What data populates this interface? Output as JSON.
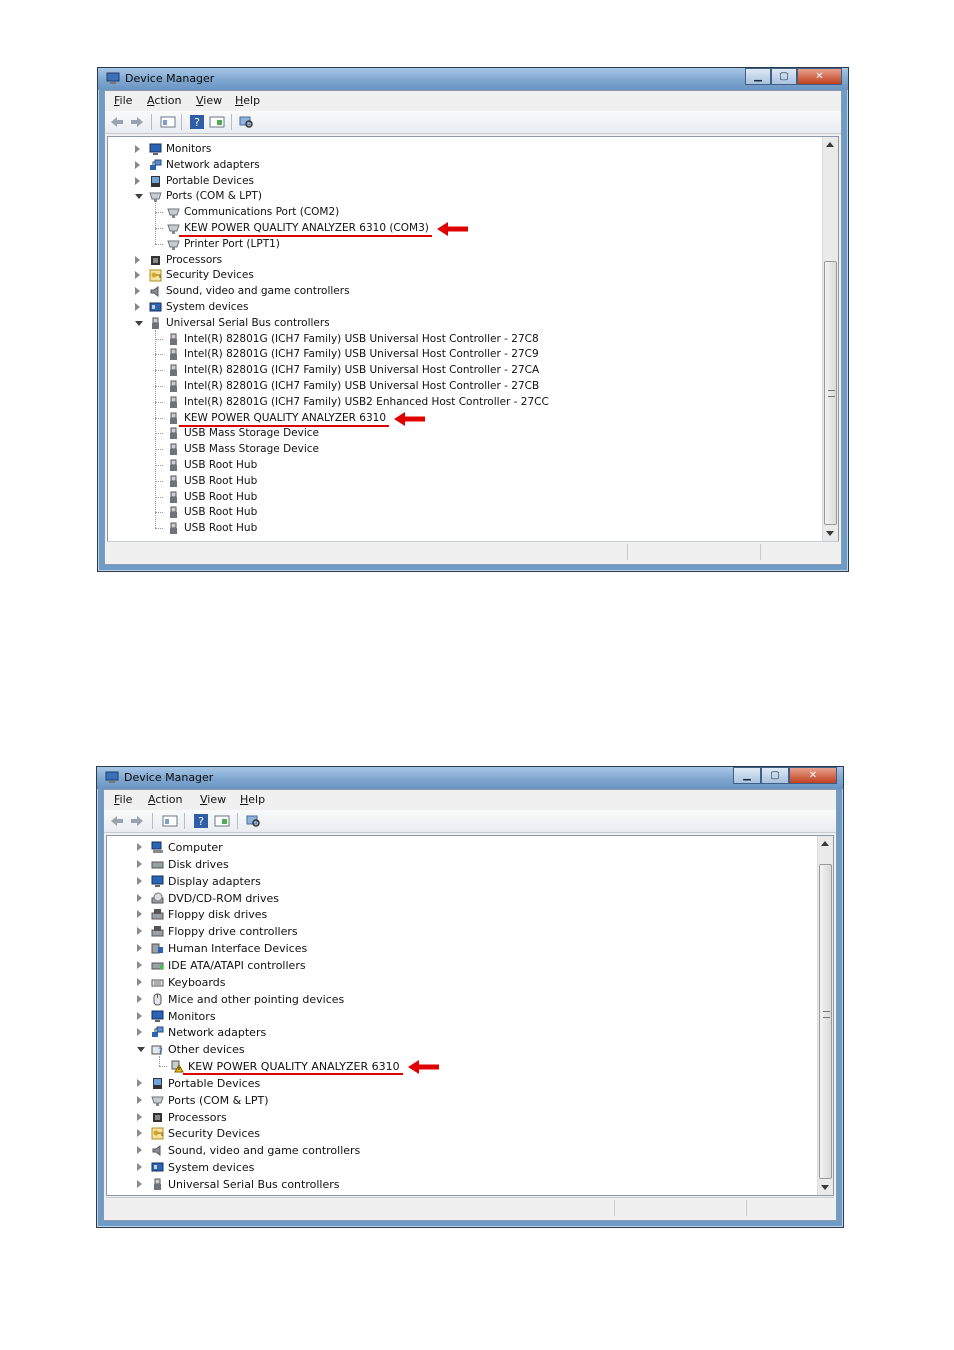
{
  "window_top": {
    "title": "Device Manager",
    "menu": [
      "File",
      "Action",
      "View",
      "Help"
    ],
    "tree": [
      {
        "label": "Monitors",
        "level": 0,
        "state": "collapsed",
        "icon": "monitor-icon"
      },
      {
        "label": "Network adapters",
        "level": 0,
        "state": "collapsed",
        "icon": "network-icon"
      },
      {
        "label": "Portable Devices",
        "level": 0,
        "state": "collapsed",
        "icon": "portable-device-icon"
      },
      {
        "label": "Ports (COM & LPT)",
        "level": 0,
        "state": "expanded",
        "icon": "port-icon"
      },
      {
        "label": "Communications Port (COM2)",
        "level": 1,
        "icon": "port-icon"
      },
      {
        "label": "KEW POWER QUALITY ANALYZER 6310 (COM3)",
        "level": 1,
        "icon": "port-icon",
        "highlight": true
      },
      {
        "label": "Printer Port (LPT1)",
        "level": 1,
        "icon": "port-icon"
      },
      {
        "label": "Processors",
        "level": 0,
        "state": "collapsed",
        "icon": "processor-icon"
      },
      {
        "label": "Security Devices",
        "level": 0,
        "state": "collapsed",
        "icon": "key-icon"
      },
      {
        "label": "Sound, video and game controllers",
        "level": 0,
        "state": "collapsed",
        "icon": "speaker-icon"
      },
      {
        "label": "System devices",
        "level": 0,
        "state": "collapsed",
        "icon": "system-icon"
      },
      {
        "label": "Universal Serial Bus controllers",
        "level": 0,
        "state": "expanded",
        "icon": "usb-icon"
      },
      {
        "label": "Intel(R) 82801G (ICH7 Family) USB Universal Host Controller - 27C8",
        "level": 1,
        "icon": "usb-icon"
      },
      {
        "label": "Intel(R) 82801G (ICH7 Family) USB Universal Host Controller - 27C9",
        "level": 1,
        "icon": "usb-icon"
      },
      {
        "label": "Intel(R) 82801G (ICH7 Family) USB Universal Host Controller - 27CA",
        "level": 1,
        "icon": "usb-icon"
      },
      {
        "label": "Intel(R) 82801G (ICH7 Family) USB Universal Host Controller - 27CB",
        "level": 1,
        "icon": "usb-icon"
      },
      {
        "label": "Intel(R) 82801G (ICH7 Family) USB2 Enhanced Host Controller - 27CC",
        "level": 1,
        "icon": "usb-icon"
      },
      {
        "label": "KEW POWER QUALITY ANALYZER 6310",
        "level": 1,
        "icon": "usb-icon",
        "highlight": true
      },
      {
        "label": "USB Mass Storage Device",
        "level": 1,
        "icon": "usb-icon"
      },
      {
        "label": "USB Mass Storage Device",
        "level": 1,
        "icon": "usb-icon"
      },
      {
        "label": "USB Root Hub",
        "level": 1,
        "icon": "usb-icon"
      },
      {
        "label": "USB Root Hub",
        "level": 1,
        "icon": "usb-icon"
      },
      {
        "label": "USB Root Hub",
        "level": 1,
        "icon": "usb-icon"
      },
      {
        "label": "USB Root Hub",
        "level": 1,
        "icon": "usb-icon"
      },
      {
        "label": "USB Root Hub",
        "level": 1,
        "icon": "usb-icon"
      }
    ]
  },
  "window_bottom": {
    "title": "Device Manager",
    "menu": [
      "File",
      "Action",
      "View",
      "Help"
    ],
    "tree": [
      {
        "label": "Computer",
        "level": 0,
        "state": "collapsed",
        "icon": "computer-icon"
      },
      {
        "label": "Disk drives",
        "level": 0,
        "state": "collapsed",
        "icon": "disk-drive-icon"
      },
      {
        "label": "Display adapters",
        "level": 0,
        "state": "collapsed",
        "icon": "monitor-icon"
      },
      {
        "label": "DVD/CD-ROM drives",
        "level": 0,
        "state": "collapsed",
        "icon": "dvd-icon"
      },
      {
        "label": "Floppy disk drives",
        "level": 0,
        "state": "collapsed",
        "icon": "floppy-icon"
      },
      {
        "label": "Floppy drive controllers",
        "level": 0,
        "state": "collapsed",
        "icon": "floppy-icon"
      },
      {
        "label": "Human Interface Devices",
        "level": 0,
        "state": "collapsed",
        "icon": "hid-icon"
      },
      {
        "label": "IDE ATA/ATAPI controllers",
        "level": 0,
        "state": "collapsed",
        "icon": "ide-icon"
      },
      {
        "label": "Keyboards",
        "level": 0,
        "state": "collapsed",
        "icon": "keyboard-icon"
      },
      {
        "label": "Mice and other pointing devices",
        "level": 0,
        "state": "collapsed",
        "icon": "mouse-icon"
      },
      {
        "label": "Monitors",
        "level": 0,
        "state": "collapsed",
        "icon": "monitor-icon"
      },
      {
        "label": "Network adapters",
        "level": 0,
        "state": "collapsed",
        "icon": "network-icon"
      },
      {
        "label": "Other devices",
        "level": 0,
        "state": "expanded",
        "icon": "unknown-device-icon"
      },
      {
        "label": "KEW POWER QUALITY ANALYZER 6310",
        "level": 1,
        "icon": "warning-device-icon",
        "highlight": true
      },
      {
        "label": "Portable Devices",
        "level": 0,
        "state": "collapsed",
        "icon": "portable-device-icon"
      },
      {
        "label": "Ports (COM & LPT)",
        "level": 0,
        "state": "collapsed",
        "icon": "port-icon"
      },
      {
        "label": "Processors",
        "level": 0,
        "state": "collapsed",
        "icon": "processor-icon"
      },
      {
        "label": "Security Devices",
        "level": 0,
        "state": "collapsed",
        "icon": "key-icon"
      },
      {
        "label": "Sound, video and game controllers",
        "level": 0,
        "state": "collapsed",
        "icon": "speaker-icon"
      },
      {
        "label": "System devices",
        "level": 0,
        "state": "collapsed",
        "icon": "system-icon"
      },
      {
        "label": "Universal Serial Bus controllers",
        "level": 0,
        "state": "collapsed",
        "icon": "usb-icon"
      }
    ]
  },
  "colors": {
    "highlight": "#e00000",
    "titlebar": "#7ea6cf"
  }
}
